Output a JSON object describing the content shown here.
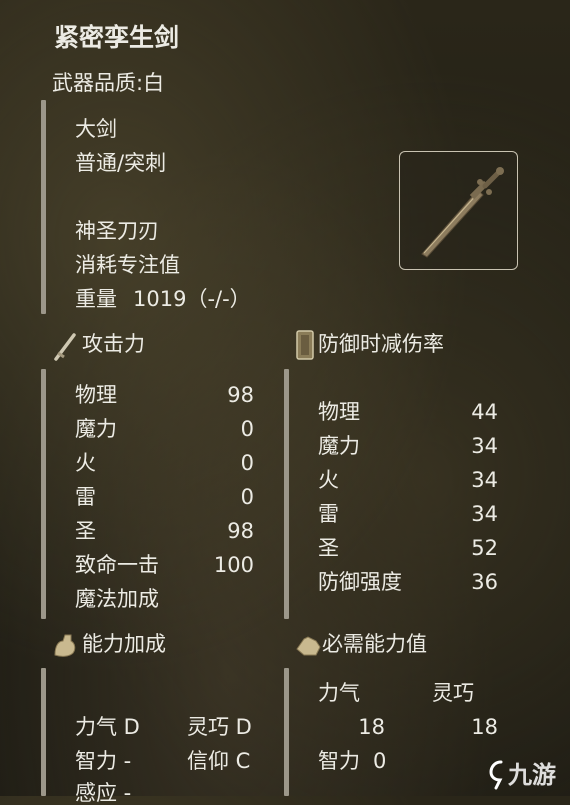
{
  "weapon": {
    "name": "紧密孪生剑",
    "quality": "武器品质:白",
    "type": "大剑",
    "attack_type": "普通/突刺",
    "skill": "神圣刀刃",
    "fp_cost": "消耗专注值",
    "weight_label": "重量",
    "weight_value": "1019（-/-）"
  },
  "attack": {
    "title": "攻击力",
    "rows": [
      {
        "label": "物理",
        "value": "98"
      },
      {
        "label": "魔力",
        "value": "0"
      },
      {
        "label": "火",
        "value": "0"
      },
      {
        "label": "雷",
        "value": "0"
      },
      {
        "label": "圣",
        "value": "98"
      },
      {
        "label": "致命一击",
        "value": "100"
      },
      {
        "label": "魔法加成",
        "value": ""
      }
    ]
  },
  "defense": {
    "title": "防御时减伤率",
    "rows": [
      {
        "label": "物理",
        "value": "44"
      },
      {
        "label": "魔力",
        "value": "34"
      },
      {
        "label": "火",
        "value": "34"
      },
      {
        "label": "雷",
        "value": "34"
      },
      {
        "label": "圣",
        "value": "52"
      },
      {
        "label": "防御强度",
        "value": "36"
      }
    ]
  },
  "scaling": {
    "title": "能力加成",
    "row1_left": "力气 D",
    "row1_right": "灵巧 D",
    "row2_left": "智力 -",
    "row2_right": "信仰 C",
    "row3_left": "感应 -"
  },
  "requirements": {
    "title": "必需能力值",
    "str_label": "力气",
    "dex_label": "灵巧",
    "str_value": "18",
    "dex_value": "18",
    "int_label": "智力",
    "int_value": "0"
  },
  "watermark": "九游",
  "icons": {
    "attack": "crossed-sword-icon",
    "defense": "shield-icon",
    "scaling": "flexed-arm-icon",
    "requirements": "hand-icon",
    "watermark": "nine-game-logo-icon"
  }
}
